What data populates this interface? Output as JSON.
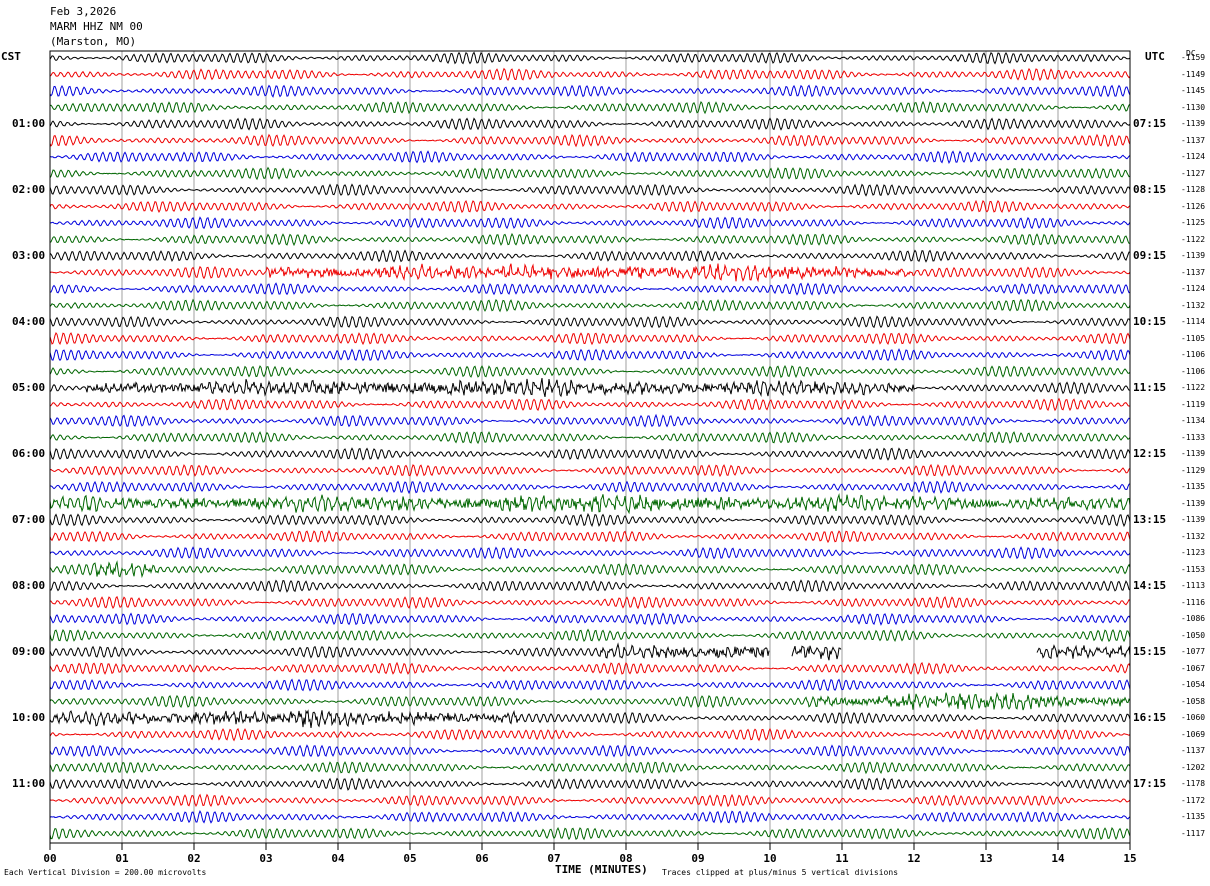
{
  "header": {
    "date": "Feb 3,2026",
    "station": "MARM HHZ NM 00",
    "location": "(Marston, MO)"
  },
  "axis": {
    "left_tz": "CST",
    "right_tz": "UTC",
    "dc_label": "DC",
    "xlabel": "TIME (MINUTES)"
  },
  "footer": {
    "division_note": "Each Vertical Division =  200.00 microvolts",
    "clip_note": "Traces clipped at plus/minus 5 vertical divisions"
  },
  "chart_data": {
    "type": "line",
    "title": "MARM HHZ NM 00 (Marston, MO)",
    "xlabel": "TIME (MINUTES)",
    "xlim": [
      0,
      15
    ],
    "x_ticks": [
      "00",
      "01",
      "02",
      "03",
      "04",
      "05",
      "06",
      "07",
      "08",
      "09",
      "10",
      "11",
      "12",
      "13",
      "14",
      "15"
    ],
    "grid": true,
    "trace_colors": [
      "#000000",
      "#ee0000",
      "#0000dd",
      "#006600"
    ],
    "hour_labels_cst": [
      "01:00",
      "02:00",
      "03:00",
      "04:00",
      "05:00",
      "06:00",
      "07:00",
      "08:00",
      "09:00",
      "10:00",
      "11:00"
    ],
    "hour_labels_utc": [
      "07:15",
      "08:15",
      "09:15",
      "10:15",
      "11:15",
      "12:15",
      "13:15",
      "14:15",
      "15:15",
      "16:15",
      "17:15"
    ],
    "dc_offsets": [
      -1159,
      -1149,
      -1145,
      -1130,
      -1139,
      -1137,
      -1124,
      -1127,
      -1128,
      -1126,
      -1125,
      -1122,
      -1139,
      -1137,
      -1124,
      -1132,
      -1114,
      -1105,
      -1106,
      -1106,
      -1122,
      -1119,
      -1134,
      -1133,
      -1139,
      -1129,
      -1135,
      -1139,
      -1139,
      -1132,
      -1123,
      -1153,
      -1113,
      -1116,
      -1086,
      -1050,
      -1077,
      -1067,
      -1054,
      -1058,
      -1060,
      -1069,
      -1137,
      -1202,
      -1178,
      -1172,
      -1135,
      -1117
    ],
    "events": [
      {
        "trace": 13,
        "x_start": 3.0,
        "x_end": 12.0,
        "note": "strong noise burst"
      },
      {
        "trace": 20,
        "x_start": 0.5,
        "x_end": 12.0,
        "note": "strong noise burst"
      },
      {
        "trace": 27,
        "x_start": 0.0,
        "x_end": 15.0,
        "note": "elevated noise"
      },
      {
        "trace": 31,
        "x_start": 0.6,
        "x_end": 1.5,
        "note": "local event"
      },
      {
        "trace": 36,
        "x_start": 7.6,
        "x_end": 15.0,
        "note": "data gaps"
      },
      {
        "trace": 39,
        "x_start": 10.5,
        "x_end": 15.0,
        "note": "elevated noise"
      },
      {
        "trace": 40,
        "x_start": 0.0,
        "x_end": 6.5,
        "note": "strong noise burst"
      }
    ],
    "gaps": [
      {
        "trace": 36,
        "x_start": 10.0,
        "x_end": 10.3
      },
      {
        "trace": 36,
        "x_start": 11.0,
        "x_end": 13.7
      }
    ]
  }
}
